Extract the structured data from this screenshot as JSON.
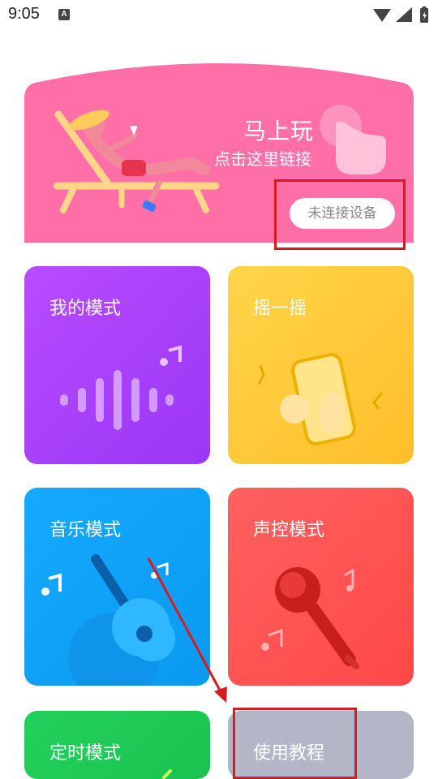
{
  "status_bar": {
    "time": "9:05",
    "notification_glyph": "A"
  },
  "banner": {
    "title": "马上玩",
    "subtitle": "点击这里链接",
    "device_button": "未连接设备"
  },
  "cards": [
    {
      "label": "我的模式",
      "color": "#a93cff",
      "icon": "sound-wave-icon"
    },
    {
      "label": "摇一摇",
      "color": "#ffcc33",
      "icon": "shake-phone-icon"
    },
    {
      "label": "音乐模式",
      "color": "#13a6fb",
      "icon": "guitar-icon"
    },
    {
      "label": "声控模式",
      "color": "#ff5656",
      "icon": "microphone-icon"
    },
    {
      "label": "定时模式",
      "color": "#22cc55",
      "icon": "timer-icon"
    },
    {
      "label": "使用教程",
      "color": "#b4b6c8",
      "icon": "tutorial-icon"
    }
  ]
}
